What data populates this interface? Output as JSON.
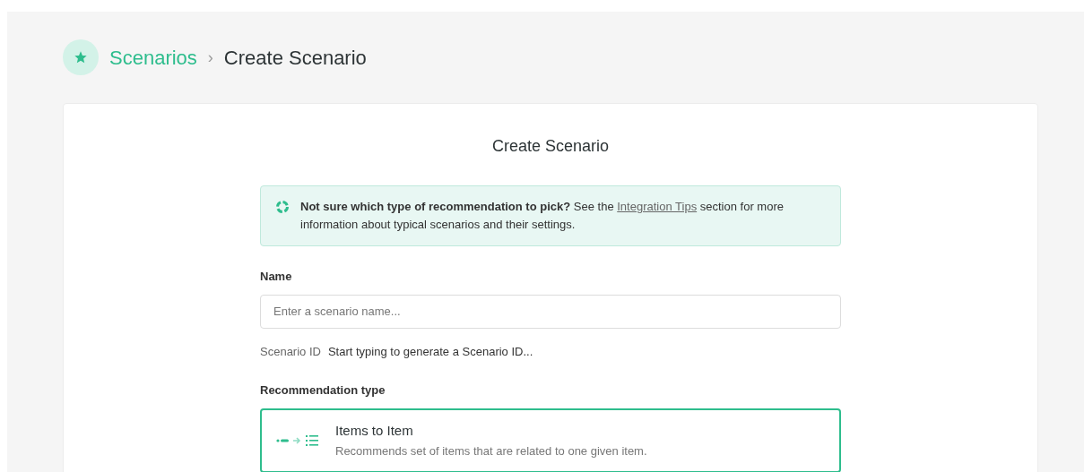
{
  "breadcrumb": {
    "parent": "Scenarios",
    "separator": "›",
    "current": "Create Scenario"
  },
  "card": {
    "title": "Create Scenario",
    "tip": {
      "bold": "Not sure which type of recommendation to pick?",
      "before_link": " See the ",
      "link": "Integration Tips",
      "after_link": " section for more information about typical scenarios and their settings."
    },
    "name_field": {
      "label": "Name",
      "placeholder": "Enter a scenario name..."
    },
    "scenario_id": {
      "label": "Scenario ID",
      "value": "Start typing to generate a Scenario ID..."
    },
    "recommendation_type": {
      "label": "Recommendation type",
      "options": [
        {
          "title": "Items to Item",
          "description": "Recommends set of items that are related to one given item.",
          "selected": true
        }
      ]
    }
  }
}
